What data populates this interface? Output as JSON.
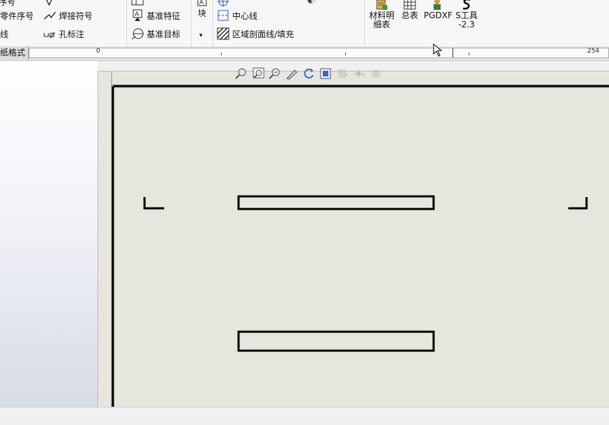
{
  "ribbon": {
    "col1": [
      "零件序号",
      "线"
    ],
    "col2": [
      "焊接符号",
      "孔标注"
    ],
    "col3": [
      "基准特征",
      "基准目标"
    ],
    "block_label": "块",
    "col5": [
      "中心线",
      "区域剖面线/填充"
    ],
    "bom_line1": "材料明",
    "bom_line2": "细表",
    "summary": "总表",
    "pgdxf": "PGDXF",
    "stool_line1": "S工具",
    "stool_line2": "-2.3"
  },
  "tabs": {
    "sheet_format": "纸格式"
  },
  "ruler": {
    "start": "0",
    "end": "254"
  },
  "colors": {
    "accent_blue": "#1f5fbf",
    "frame": "#000000",
    "sheet": "#e7e6de"
  }
}
